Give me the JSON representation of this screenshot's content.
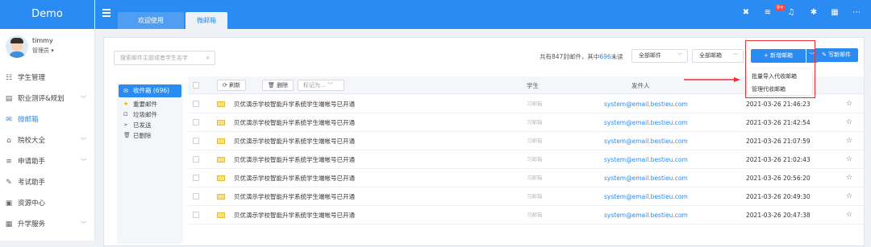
{
  "app": {
    "title": "Demo"
  },
  "user": {
    "name": "timmy",
    "role": "管理员 ▾"
  },
  "sidebar": {
    "items": [
      {
        "label": "学生管理",
        "icon": "users-icon",
        "chevron": false
      },
      {
        "label": "职业测评&规划",
        "icon": "briefcase-icon",
        "chevron": true
      },
      {
        "label": "微邮箱",
        "icon": "mail-icon",
        "chevron": false,
        "active": true
      },
      {
        "label": "院校大全",
        "icon": "building-icon",
        "chevron": true
      },
      {
        "label": "申请助手",
        "icon": "list-icon",
        "chevron": true
      },
      {
        "label": "考试助手",
        "icon": "edit-icon",
        "chevron": false
      },
      {
        "label": "资源中心",
        "icon": "folder-icon",
        "chevron": false
      },
      {
        "label": "升学服务",
        "icon": "grid-icon",
        "chevron": true
      }
    ]
  },
  "tabs": [
    {
      "label": "欢迎使用"
    },
    {
      "label": "微邮箱"
    }
  ],
  "topbar": {
    "badge": "9+"
  },
  "search": {
    "placeholder": "搜索邮件主题或者学生名字"
  },
  "summary": {
    "prefix": "共有847封邮件，其中",
    "unread": "696",
    "suffix": "未读"
  },
  "filters": {
    "filter1": "全部邮件",
    "filter2": "全部邮箱"
  },
  "buttons": {
    "new_mail": "+ 新增邮箱",
    "write_mail": "写新邮件"
  },
  "dropdown_menu": [
    "批量导入代收邮箱",
    "管理代收邮箱"
  ],
  "folders": [
    {
      "label": "收件箱 (696)",
      "icon": "inbox-icon"
    },
    {
      "label": "重要邮件",
      "icon": "star-icon"
    },
    {
      "label": "垃圾邮件",
      "icon": "trash-box-icon"
    },
    {
      "label": "已发送",
      "icon": "send-icon"
    },
    {
      "label": "已删除",
      "icon": "delete-icon"
    }
  ],
  "toolbar": {
    "refresh": "刷新",
    "delete": "删除",
    "mark_as": "标记为..."
  },
  "columns": {
    "student": "学生",
    "sender": "发件人"
  },
  "rows": [
    {
      "subject": "贝优演示学校智能升学系统学生端帐号已开通",
      "student": "习邮箱",
      "from": "system@email.bestieu.com",
      "time": "2021-03-26 21:46:23"
    },
    {
      "subject": "贝优演示学校智能升学系统学生端帐号已开通",
      "student": "习邮箱",
      "from": "system@email.bestieu.com",
      "time": "2021-03-26 21:42:54"
    },
    {
      "subject": "贝优演示学校智能升学系统学生端帐号已开通",
      "student": "习邮箱",
      "from": "system@email.bestieu.com",
      "time": "2021-03-26 21:07:59"
    },
    {
      "subject": "贝优演示学校智能升学系统学生端帐号已开通",
      "student": "习邮箱",
      "from": "system@email.bestieu.com",
      "time": "2021-03-26 21:02:43"
    },
    {
      "subject": "贝优演示学校智能升学系统学生端帐号已开通",
      "student": "习邮箱",
      "from": "system@email.bestieu.com",
      "time": "2021-03-26 20:56:20"
    },
    {
      "subject": "贝优演示学校智能升学系统学生端帐号已开通",
      "student": "习邮箱",
      "from": "system@email.bestieu.com",
      "time": "2021-03-26 20:49:30"
    },
    {
      "subject": "贝优演示学校智能升学系统学生端帐号已开通",
      "student": "习邮箱",
      "from": "system@email.bestieu.com",
      "time": "2021-03-26 20:47:38"
    }
  ]
}
